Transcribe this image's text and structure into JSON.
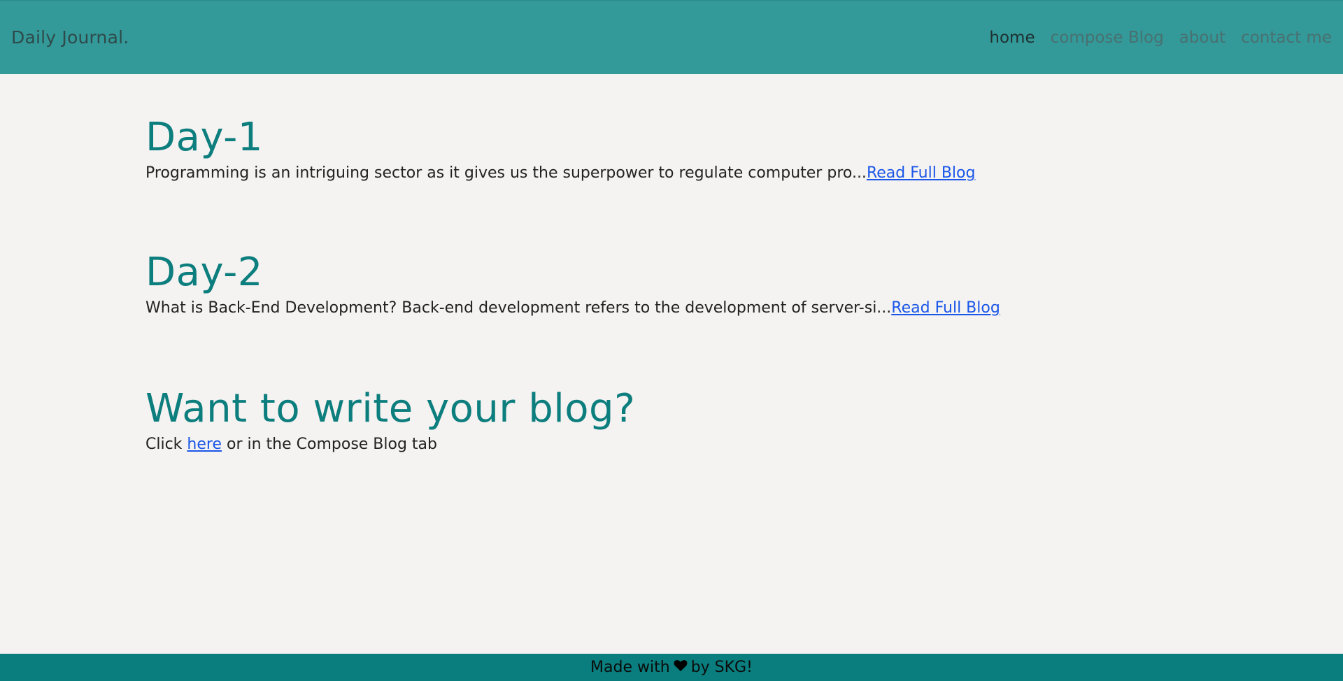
{
  "navbar": {
    "brand": "Daily Journal.",
    "links": [
      {
        "label": "home",
        "active": true
      },
      {
        "label": "compose Blog",
        "active": false
      },
      {
        "label": "about",
        "active": false
      },
      {
        "label": "contact me",
        "active": false
      }
    ]
  },
  "posts": [
    {
      "title": "Day-1",
      "excerpt": "Programming is an intriguing sector as it gives us the superpower to regulate computer pro...",
      "link_label": "Read Full Blog"
    },
    {
      "title": "Day-2",
      "excerpt": "What is Back-End Development? Back-end development refers to the development of server-si...",
      "link_label": "Read Full Blog"
    }
  ],
  "cta": {
    "title": "Want to write your blog?",
    "prefix": "Click ",
    "link_label": "here",
    "suffix": " or in the Compose Blog tab"
  },
  "footer": {
    "prefix": "Made with",
    "heart_icon": "heart-icon",
    "suffix": "by SKG!"
  },
  "colors": {
    "navbar_bg": "#339999",
    "heading": "#0d7e7e",
    "link": "#1a56e8",
    "footer_bg": "#0a7e7e",
    "page_bg": "#f5f3f1"
  }
}
